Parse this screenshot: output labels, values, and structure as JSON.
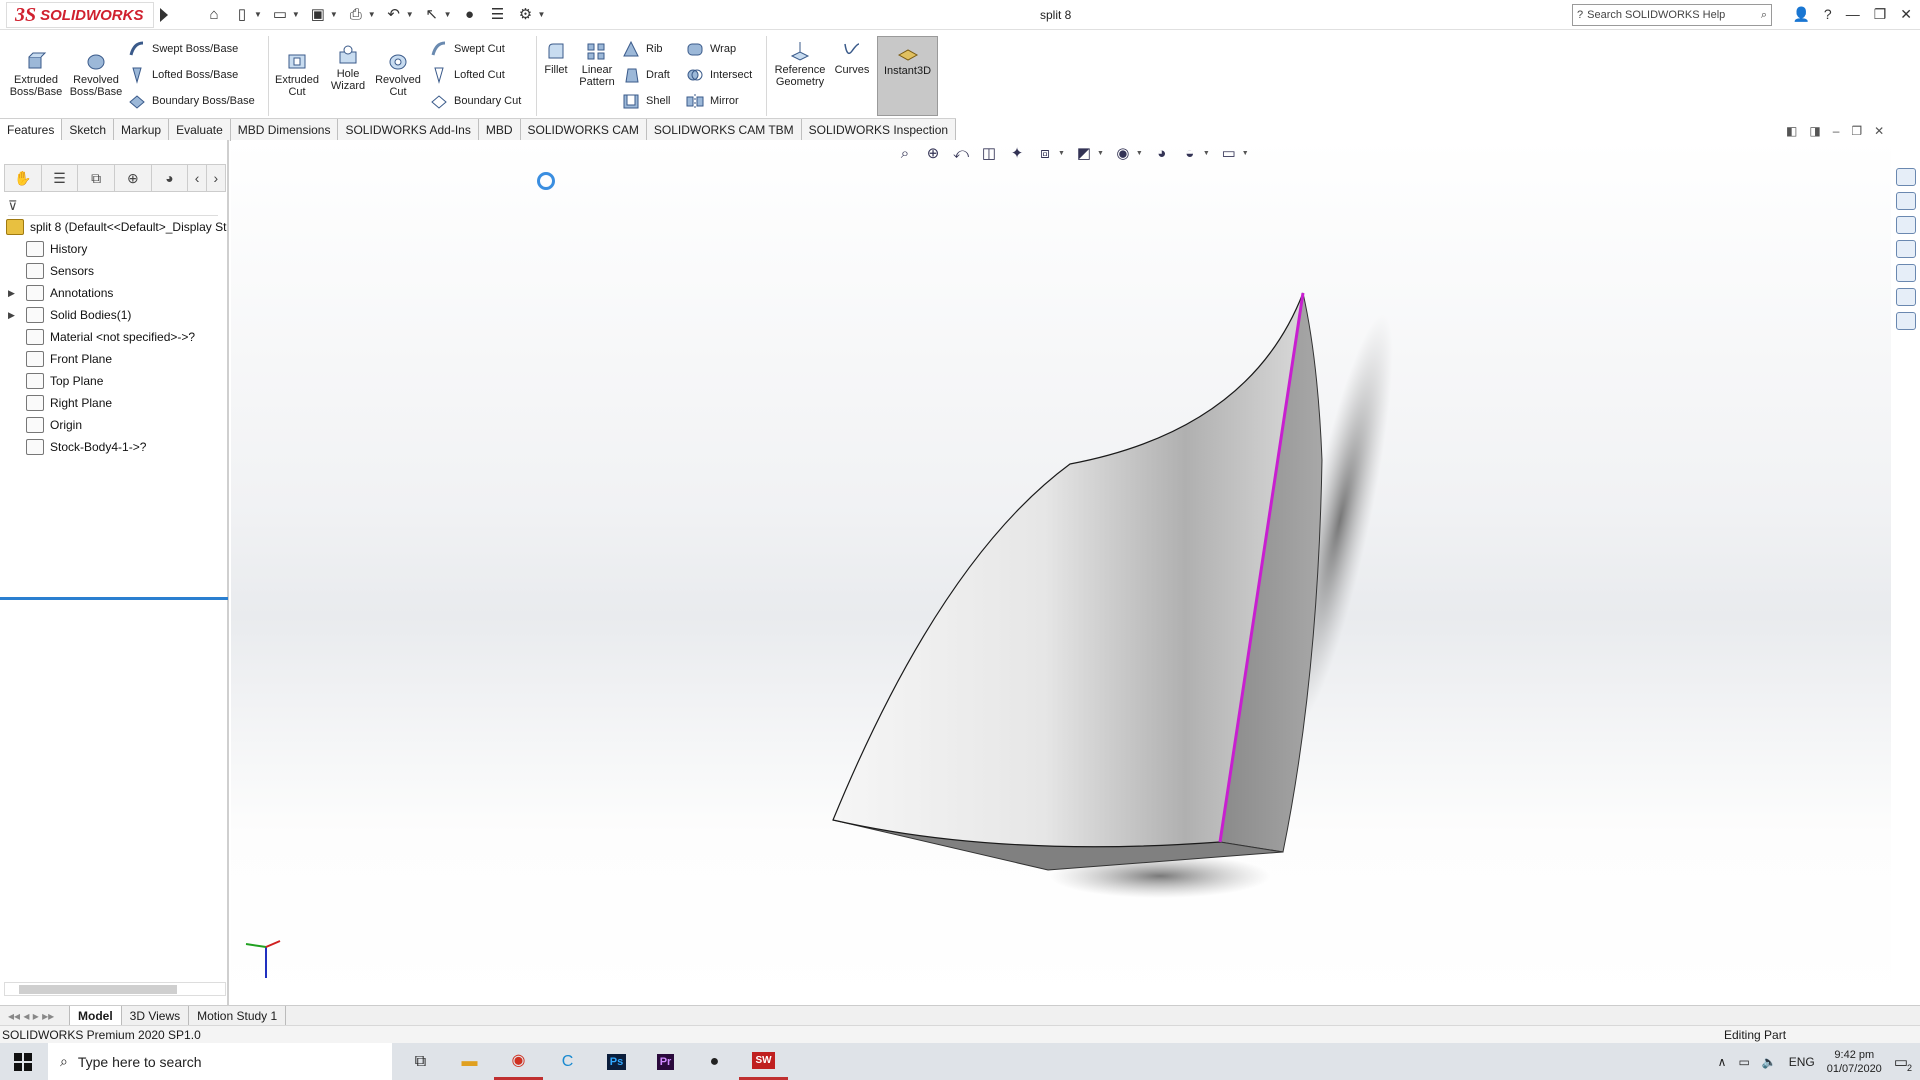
{
  "app": {
    "logo_mark": "3S",
    "logo_name": "SOLIDWORKS",
    "doc_title": "split 8"
  },
  "quick_access": [
    "home-icon",
    "new-icon",
    "open-icon",
    "save-icon",
    "print-icon",
    "undo-icon",
    "select-icon",
    "traffic-light-icon",
    "file-props-icon",
    "options-icon"
  ],
  "search": {
    "placeholder": "Search SOLIDWORKS Help"
  },
  "toolbar": {
    "extruded_boss": "Extruded Boss/Base",
    "revolved_boss": "Revolved Boss/Base",
    "swept_boss": "Swept Boss/Base",
    "lofted_boss": "Lofted Boss/Base",
    "boundary_boss": "Boundary Boss/Base",
    "extruded_cut": "Extruded Cut",
    "hole_wizard": "Hole Wizard",
    "revolved_cut": "Revolved Cut",
    "swept_cut": "Swept Cut",
    "lofted_cut": "Lofted Cut",
    "boundary_cut": "Boundary Cut",
    "fillet": "Fillet",
    "linear_pattern": "Linear Pattern",
    "rib": "Rib",
    "draft": "Draft",
    "shell": "Shell",
    "wrap": "Wrap",
    "intersect": "Intersect",
    "mirror": "Mirror",
    "reference_geometry": "Reference Geometry",
    "curves": "Curves",
    "instant3d": "Instant3D"
  },
  "tabs": [
    "Features",
    "Sketch",
    "Markup",
    "Evaluate",
    "MBD Dimensions",
    "SOLIDWORKS Add-Ins",
    "MBD",
    "SOLIDWORKS CAM",
    "SOLIDWORKS CAM TBM",
    "SOLIDWORKS Inspection"
  ],
  "tree": {
    "root": "split 8  (Default<<Default>_Display St",
    "items": [
      "History",
      "Sensors",
      "Annotations",
      "Solid Bodies(1)",
      "Material <not specified>->?",
      "Front Plane",
      "Top Plane",
      "Right Plane",
      "Origin",
      "Stock-Body4-1->?"
    ]
  },
  "bottom_tabs": [
    "Model",
    "3D Views",
    "Motion Study 1"
  ],
  "status": {
    "left": "SOLIDWORKS Premium 2020 SP1.0",
    "right": "Editing Part"
  },
  "taskbar": {
    "search_placeholder": "Type here to search",
    "lang": "ENG",
    "time": "9:42 pm",
    "date": "01/07/2020",
    "notif_count": "2"
  },
  "colors": {
    "accent": "#2a7fd0",
    "edge_highlight": "#c81fd0",
    "brand": "#d0202e"
  }
}
